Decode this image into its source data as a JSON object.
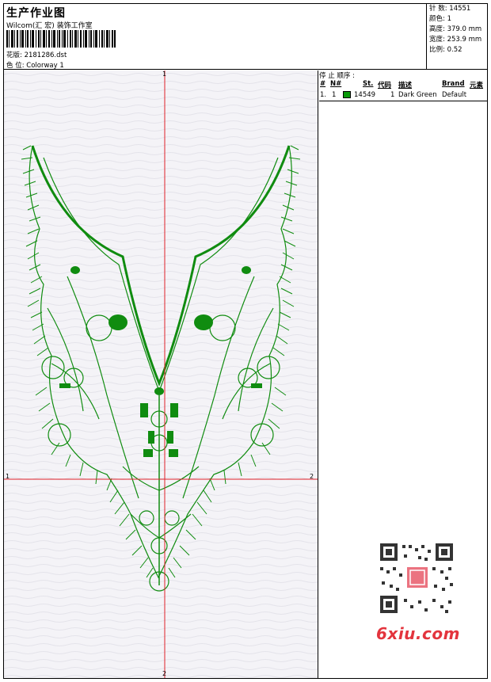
{
  "header": {
    "title": "生产作业图",
    "company": "Wilcom(汇 宏) 装饰工作室",
    "design_label": "花版:",
    "design_file": "2181286.dst",
    "colorway_label": "色 位:",
    "colorway": "Colorway 1"
  },
  "stats": {
    "stitches_label": "针 数:",
    "stitches": "14551",
    "colors_label": "颜色:",
    "colors": "1",
    "height_label": "高度:",
    "height": "379.0 mm",
    "width_label": "宽度:",
    "width": "253.9 mm",
    "scale_label": "比例:",
    "scale": "0.52"
  },
  "sequence": {
    "label": "停 止 顺序 :",
    "columns": [
      "#",
      "N#",
      "St.",
      "代码",
      "描述",
      "Brand",
      "元素"
    ],
    "rows": [
      {
        "index": "1.",
        "needle": "1",
        "stitches": "14549",
        "code": "1",
        "description": "Dark Green",
        "brand": "Default",
        "color": "#0a9a0a"
      }
    ]
  },
  "axes": {
    "top_label": "1",
    "bottom_label": "2",
    "left_label": "1",
    "right_label": "2"
  },
  "colors": {
    "thread": "#108c10",
    "crosshair": "#e0202a",
    "watermark": "#e3343d"
  },
  "watermark": {
    "text": "6xiu.com"
  }
}
